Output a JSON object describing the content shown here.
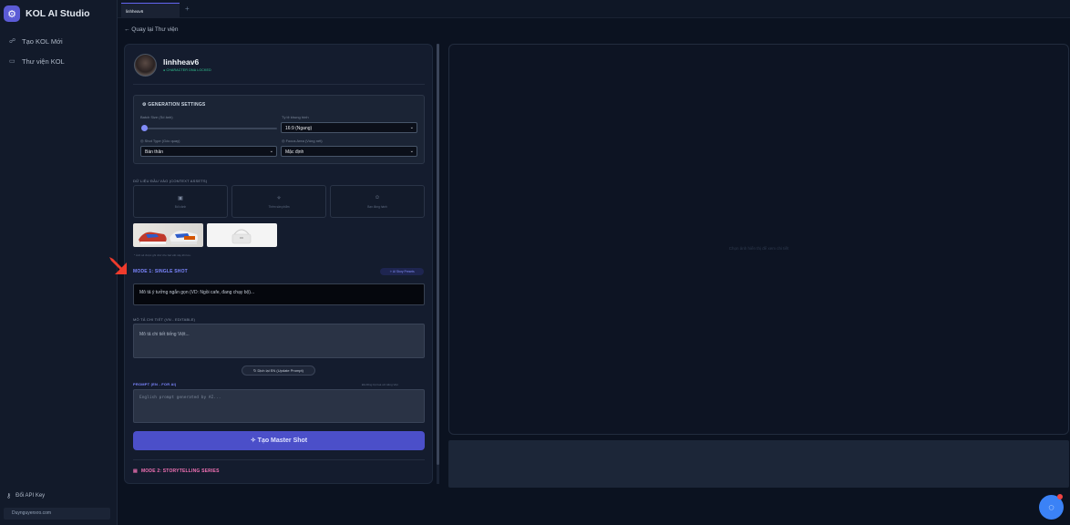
{
  "sidebar": {
    "brand": "KOL AI Studio",
    "items": [
      {
        "icon": "add-user-icon",
        "label": "Tạo KOL Mới"
      },
      {
        "icon": "folder-icon",
        "label": "Thư viện KOL"
      }
    ],
    "api_key_label": "Đổi API Key",
    "site": "Duynguyenxro.com"
  },
  "tabs": [
    {
      "label": "linhheav6"
    }
  ],
  "tab_add": "+",
  "back_link": "← Quay lại Thư viện",
  "profile": {
    "username": "linhheav6",
    "status": "● CHARACTER DNA LOCKED"
  },
  "generation": {
    "title": "GENERATION SETTINGS",
    "batch_label": "Batch Size (Số ảnh)",
    "batch_value": 1,
    "ratio_label": "Tỷ lệ khung hình",
    "ratio_value": "16:9 (Ngang)",
    "shot_label": "Shot Type (Góc quay)",
    "shot_value": "Bán thân",
    "focus_label": "Focus Area (Vùng nét)",
    "focus_value": "Mặc định"
  },
  "context": {
    "title": "DỮ LIỆU ĐẦU VÀO (CONTEXT ASSETS)",
    "assets": [
      {
        "icon": "image-icon",
        "label": "Bối cảnh"
      },
      {
        "icon": "sparkle-icon",
        "label": "Thêm sản phẩm"
      },
      {
        "icon": "user-icon",
        "label": "Bạn đồng hành"
      }
    ],
    "note": "* Ảnh sẽ được ghi nhớ cho bài viết này khi lưu."
  },
  "mode1": {
    "title": "MODE 1: SINGLE SHOT",
    "badge": "AI Story Presets",
    "idea_value": "Mô tả ý tưởng ngắn gọn (VD: Ngồi cafe, đang chạy bộ)...",
    "detail_label": "MÔ TẢ CHI TIẾT (VN - EDITABLE)",
    "detail_placeholder": "Mô tả chi tiết tiếng Việt...",
    "translate_button": "Dịch lại EN (Update Prompt)",
    "prompt_label": "PROMPT (EN - FOR AI)",
    "prompt_hint": "Đã đồng bộ hoá với tiếng Việt",
    "prompt_placeholder": "English prompt generated by AI...",
    "generate_button": "Tạo Master Shot"
  },
  "mode2": {
    "title": "MODE 2: STORYTELLING SERIES"
  },
  "preview": {
    "empty_text": "Chọn ảnh hiển thị để xem chi tiết"
  },
  "colors": {
    "accent": "#5b5bd6",
    "mode1": "#7c86ff",
    "mode2": "#f472b6",
    "locked": "#34d399",
    "arrow": "#ef3b2c"
  }
}
